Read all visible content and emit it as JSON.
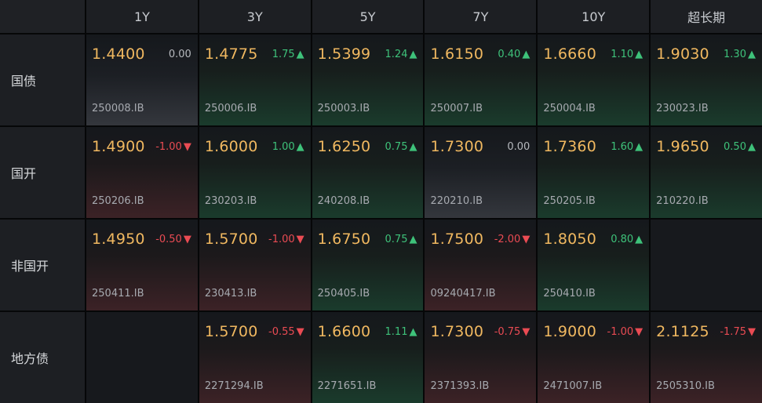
{
  "header": {
    "tenors": [
      "1Y",
      "3Y",
      "5Y",
      "7Y",
      "10Y",
      "超长期"
    ]
  },
  "arrows": {
    "up": "▲",
    "down": "▼"
  },
  "colors": {
    "yield": "#f0b860",
    "up": "#3ec27a",
    "down": "#ea4b53",
    "flat": "#b6b9be"
  },
  "rows": [
    {
      "label": "国债",
      "cells": [
        {
          "yield": "1.4400",
          "change": "0.00",
          "dir": "flat",
          "code": "250008.IB"
        },
        {
          "yield": "1.4775",
          "change": "1.75",
          "dir": "up",
          "code": "250006.IB"
        },
        {
          "yield": "1.5399",
          "change": "1.24",
          "dir": "up",
          "code": "250003.IB"
        },
        {
          "yield": "1.6150",
          "change": "0.40",
          "dir": "up",
          "code": "250007.IB"
        },
        {
          "yield": "1.6660",
          "change": "1.10",
          "dir": "up",
          "code": "250004.IB"
        },
        {
          "yield": "1.9030",
          "change": "1.30",
          "dir": "up",
          "code": "230023.IB"
        }
      ]
    },
    {
      "label": "国开",
      "cells": [
        {
          "yield": "1.4900",
          "change": "-1.00",
          "dir": "down",
          "code": "250206.IB"
        },
        {
          "yield": "1.6000",
          "change": "1.00",
          "dir": "up",
          "code": "230203.IB"
        },
        {
          "yield": "1.6250",
          "change": "0.75",
          "dir": "up",
          "code": "240208.IB"
        },
        {
          "yield": "1.7300",
          "change": "0.00",
          "dir": "flat",
          "code": "220210.IB"
        },
        {
          "yield": "1.7360",
          "change": "1.60",
          "dir": "up",
          "code": "250205.IB"
        },
        {
          "yield": "1.9650",
          "change": "0.50",
          "dir": "up",
          "code": "210220.IB"
        }
      ]
    },
    {
      "label": "非国开",
      "cells": [
        {
          "yield": "1.4950",
          "change": "-0.50",
          "dir": "down",
          "code": "250411.IB"
        },
        {
          "yield": "1.5700",
          "change": "-1.00",
          "dir": "down",
          "code": "230413.IB"
        },
        {
          "yield": "1.6750",
          "change": "0.75",
          "dir": "up",
          "code": "250405.IB"
        },
        {
          "yield": "1.7500",
          "change": "-2.00",
          "dir": "down",
          "code": "09240417.IB"
        },
        {
          "yield": "1.8050",
          "change": "0.80",
          "dir": "up",
          "code": "250410.IB"
        },
        null
      ]
    },
    {
      "label": "地方债",
      "cells": [
        null,
        {
          "yield": "1.5700",
          "change": "-0.55",
          "dir": "down",
          "code": "2271294.IB"
        },
        {
          "yield": "1.6600",
          "change": "1.11",
          "dir": "up",
          "code": "2271651.IB"
        },
        {
          "yield": "1.7300",
          "change": "-0.75",
          "dir": "down",
          "code": "2371393.IB"
        },
        {
          "yield": "1.9000",
          "change": "-1.00",
          "dir": "down",
          "code": "2471007.IB"
        },
        {
          "yield": "2.1125",
          "change": "-1.75",
          "dir": "down",
          "code": "2505310.IB"
        }
      ]
    }
  ]
}
